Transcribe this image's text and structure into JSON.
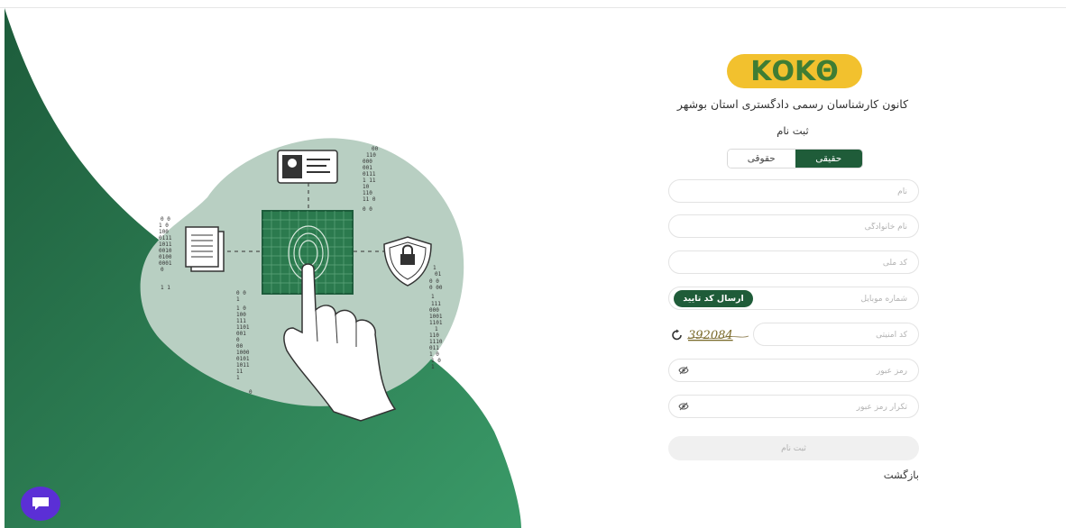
{
  "brand": {
    "logo_text": "ΚΟΚΘ",
    "org_name": "کانون کارشناسان رسمی دادگستری استان بوشهر"
  },
  "form": {
    "title": "ثبت نام",
    "tabs": [
      {
        "label": "حقیقی",
        "active": true
      },
      {
        "label": "حقوقی",
        "active": false
      }
    ],
    "fields": {
      "first_name": {
        "placeholder": "نام"
      },
      "last_name": {
        "placeholder": "نام خانوادگی"
      },
      "national_code": {
        "placeholder": "کد ملی"
      },
      "mobile": {
        "placeholder": "شماره موبایل"
      },
      "captcha": {
        "placeholder": "کد امنیتی"
      },
      "password": {
        "placeholder": "رمز عبور"
      },
      "password_confirm": {
        "placeholder": "تکرار رمز عبور"
      }
    },
    "send_code_label": "ارسال کد تایید",
    "captcha_text": "392084",
    "submit_label": "ثبت نام",
    "back_label": "بازگشت"
  },
  "colors": {
    "accent": "#1f5c39",
    "green_bg": "#2e8a58",
    "blob": "#b8cfc2",
    "logo_yellow": "#f2c12e",
    "chat": "#5b2fd6"
  },
  "icons": {
    "chat": "chat-bubble-icon",
    "eye": "eye-off-icon",
    "refresh": "refresh-icon"
  }
}
